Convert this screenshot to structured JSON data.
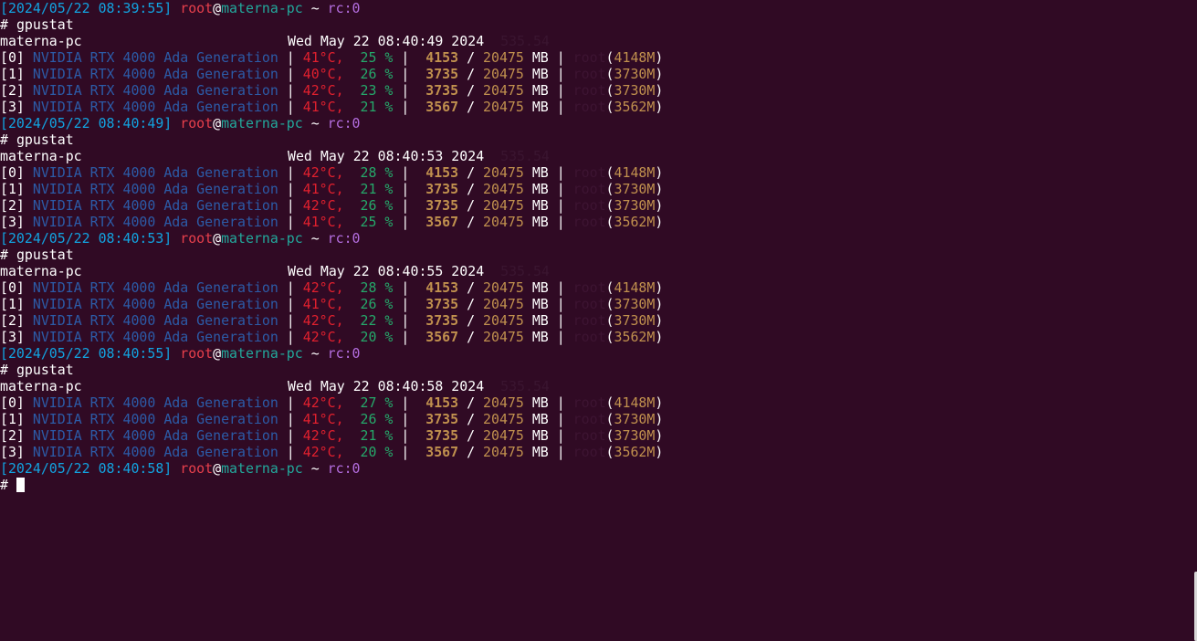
{
  "prompt": {
    "user": "root",
    "at": "@",
    "host": "materna-pc",
    "tilde": "~",
    "rc": "rc:0",
    "hash": "# "
  },
  "blocks": [
    {
      "prompt_timestamp": "[2024/05/22 08:39:55]",
      "command": "gpustat",
      "hostname": "materna-pc",
      "datetime": "Wed May 22 08:40:49 2024",
      "driver": "535.54",
      "gpus": [
        {
          "index": "[0]",
          "name": "NVIDIA RTX 4000 Ada Generation",
          "temp": "41°C,",
          "util": "25 %",
          "mem_used": "4153",
          "mem_total": "20475",
          "unit": "MB",
          "proc_user": "root",
          "proc_mem": "4148M"
        },
        {
          "index": "[1]",
          "name": "NVIDIA RTX 4000 Ada Generation",
          "temp": "40°C,",
          "util": "26 %",
          "mem_used": "3735",
          "mem_total": "20475",
          "unit": "MB",
          "proc_user": "root",
          "proc_mem": "3730M"
        },
        {
          "index": "[2]",
          "name": "NVIDIA RTX 4000 Ada Generation",
          "temp": "42°C,",
          "util": "23 %",
          "mem_used": "3735",
          "mem_total": "20475",
          "unit": "MB",
          "proc_user": "root",
          "proc_mem": "3730M"
        },
        {
          "index": "[3]",
          "name": "NVIDIA RTX 4000 Ada Generation",
          "temp": "41°C,",
          "util": "21 %",
          "mem_used": "3567",
          "mem_total": "20475",
          "unit": "MB",
          "proc_user": "root",
          "proc_mem": "3562M"
        }
      ]
    },
    {
      "prompt_timestamp": "[2024/05/22 08:40:49]",
      "command": "gpustat",
      "hostname": "materna-pc",
      "datetime": "Wed May 22 08:40:53 2024",
      "driver": "535.54",
      "gpus": [
        {
          "index": "[0]",
          "name": "NVIDIA RTX 4000 Ada Generation",
          "temp": "42°C,",
          "util": "28 %",
          "mem_used": "4153",
          "mem_total": "20475",
          "unit": "MB",
          "proc_user": "root",
          "proc_mem": "4148M"
        },
        {
          "index": "[1]",
          "name": "NVIDIA RTX 4000 Ada Generation",
          "temp": "41°C,",
          "util": "21 %",
          "mem_used": "3735",
          "mem_total": "20475",
          "unit": "MB",
          "proc_user": "root",
          "proc_mem": "3730M"
        },
        {
          "index": "[2]",
          "name": "NVIDIA RTX 4000 Ada Generation",
          "temp": "42°C,",
          "util": "26 %",
          "mem_used": "3735",
          "mem_total": "20475",
          "unit": "MB",
          "proc_user": "root",
          "proc_mem": "3730M"
        },
        {
          "index": "[3]",
          "name": "NVIDIA RTX 4000 Ada Generation",
          "temp": "41°C,",
          "util": "25 %",
          "mem_used": "3567",
          "mem_total": "20475",
          "unit": "MB",
          "proc_user": "root",
          "proc_mem": "3562M"
        }
      ]
    },
    {
      "prompt_timestamp": "[2024/05/22 08:40:53]",
      "command": "gpustat",
      "hostname": "materna-pc",
      "datetime": "Wed May 22 08:40:55 2024",
      "driver": "535.54",
      "gpus": [
        {
          "index": "[0]",
          "name": "NVIDIA RTX 4000 Ada Generation",
          "temp": "42°C,",
          "util": "28 %",
          "mem_used": "4153",
          "mem_total": "20475",
          "unit": "MB",
          "proc_user": "root",
          "proc_mem": "4148M"
        },
        {
          "index": "[1]",
          "name": "NVIDIA RTX 4000 Ada Generation",
          "temp": "41°C,",
          "util": "26 %",
          "mem_used": "3735",
          "mem_total": "20475",
          "unit": "MB",
          "proc_user": "root",
          "proc_mem": "3730M"
        },
        {
          "index": "[2]",
          "name": "NVIDIA RTX 4000 Ada Generation",
          "temp": "42°C,",
          "util": "22 %",
          "mem_used": "3735",
          "mem_total": "20475",
          "unit": "MB",
          "proc_user": "root",
          "proc_mem": "3730M"
        },
        {
          "index": "[3]",
          "name": "NVIDIA RTX 4000 Ada Generation",
          "temp": "42°C,",
          "util": "20 %",
          "mem_used": "3567",
          "mem_total": "20475",
          "unit": "MB",
          "proc_user": "root",
          "proc_mem": "3562M"
        }
      ]
    },
    {
      "prompt_timestamp": "[2024/05/22 08:40:55]",
      "command": "gpustat",
      "hostname": "materna-pc",
      "datetime": "Wed May 22 08:40:58 2024",
      "driver": "535.54",
      "gpus": [
        {
          "index": "[0]",
          "name": "NVIDIA RTX 4000 Ada Generation",
          "temp": "42°C,",
          "util": "27 %",
          "mem_used": "4153",
          "mem_total": "20475",
          "unit": "MB",
          "proc_user": "root",
          "proc_mem": "4148M"
        },
        {
          "index": "[1]",
          "name": "NVIDIA RTX 4000 Ada Generation",
          "temp": "41°C,",
          "util": "26 %",
          "mem_used": "3735",
          "mem_total": "20475",
          "unit": "MB",
          "proc_user": "root",
          "proc_mem": "3730M"
        },
        {
          "index": "[2]",
          "name": "NVIDIA RTX 4000 Ada Generation",
          "temp": "42°C,",
          "util": "21 %",
          "mem_used": "3735",
          "mem_total": "20475",
          "unit": "MB",
          "proc_user": "root",
          "proc_mem": "3730M"
        },
        {
          "index": "[3]",
          "name": "NVIDIA RTX 4000 Ada Generation",
          "temp": "42°C,",
          "util": "20 %",
          "mem_used": "3567",
          "mem_total": "20475",
          "unit": "MB",
          "proc_user": "root",
          "proc_mem": "3562M"
        }
      ]
    }
  ],
  "final_prompt": {
    "timestamp": "[2024/05/22 08:40:58]",
    "hash": "# "
  }
}
